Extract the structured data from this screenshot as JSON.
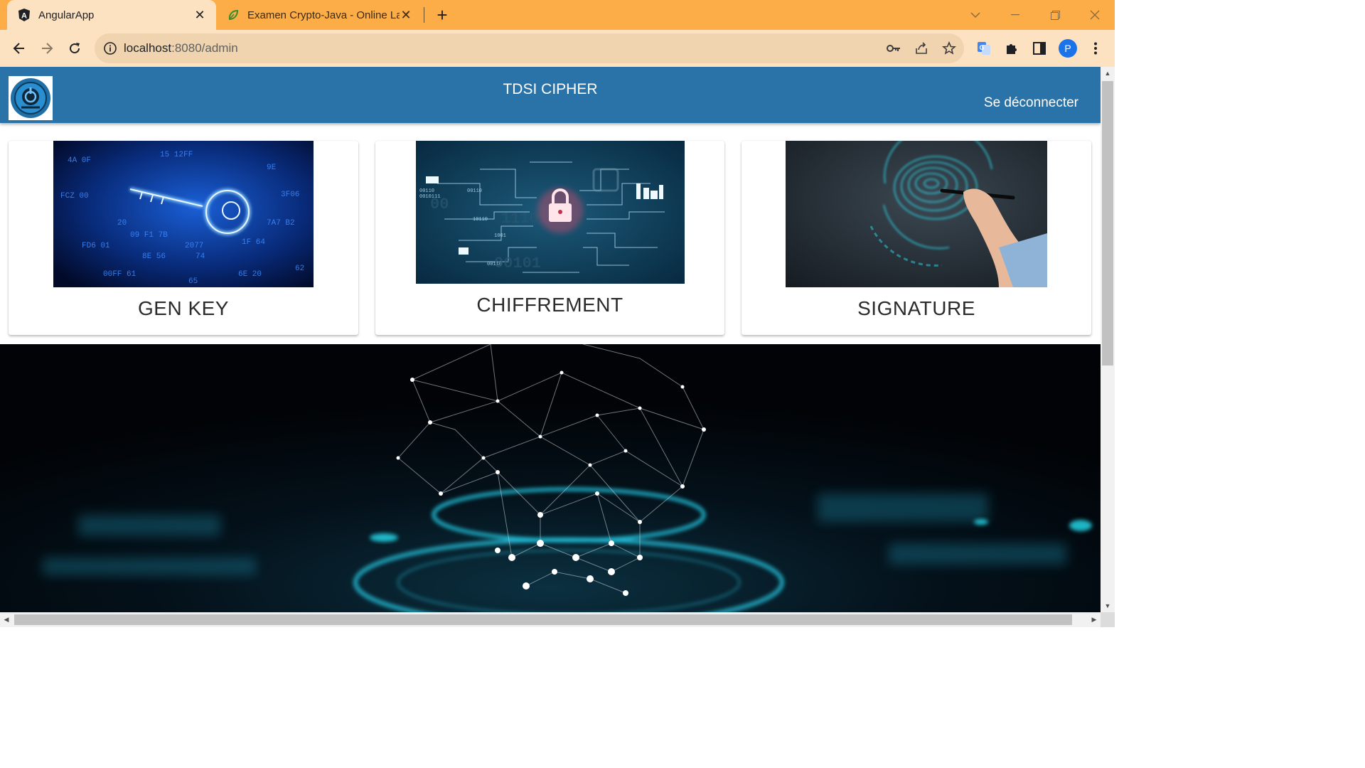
{
  "browser": {
    "tabs": [
      {
        "title": "AngularApp",
        "active": true,
        "favicon": "angular-icon"
      },
      {
        "title": "Examen Crypto-Java - Online La",
        "active": false,
        "favicon": "leaf-icon"
      }
    ],
    "address": {
      "host": "localhost",
      "path": ":8080/admin"
    },
    "profile_initial": "P"
  },
  "app": {
    "title": "TDSI CIPHER",
    "logout_label": "Se déconnecter",
    "cards": [
      {
        "label": "GEN KEY",
        "image": "glowing-key-binary-image"
      },
      {
        "label": "CHIFFREMENT",
        "image": "padlock-circuit-image"
      },
      {
        "label": "SIGNATURE",
        "image": "digital-fingerprint-pen-image"
      }
    ],
    "hero_image": "network-hologram-image"
  },
  "colors": {
    "tabbar": "#fdad47",
    "toolbar": "#fde2c2",
    "appbar": "#2a73a8",
    "hero": "#020409"
  }
}
